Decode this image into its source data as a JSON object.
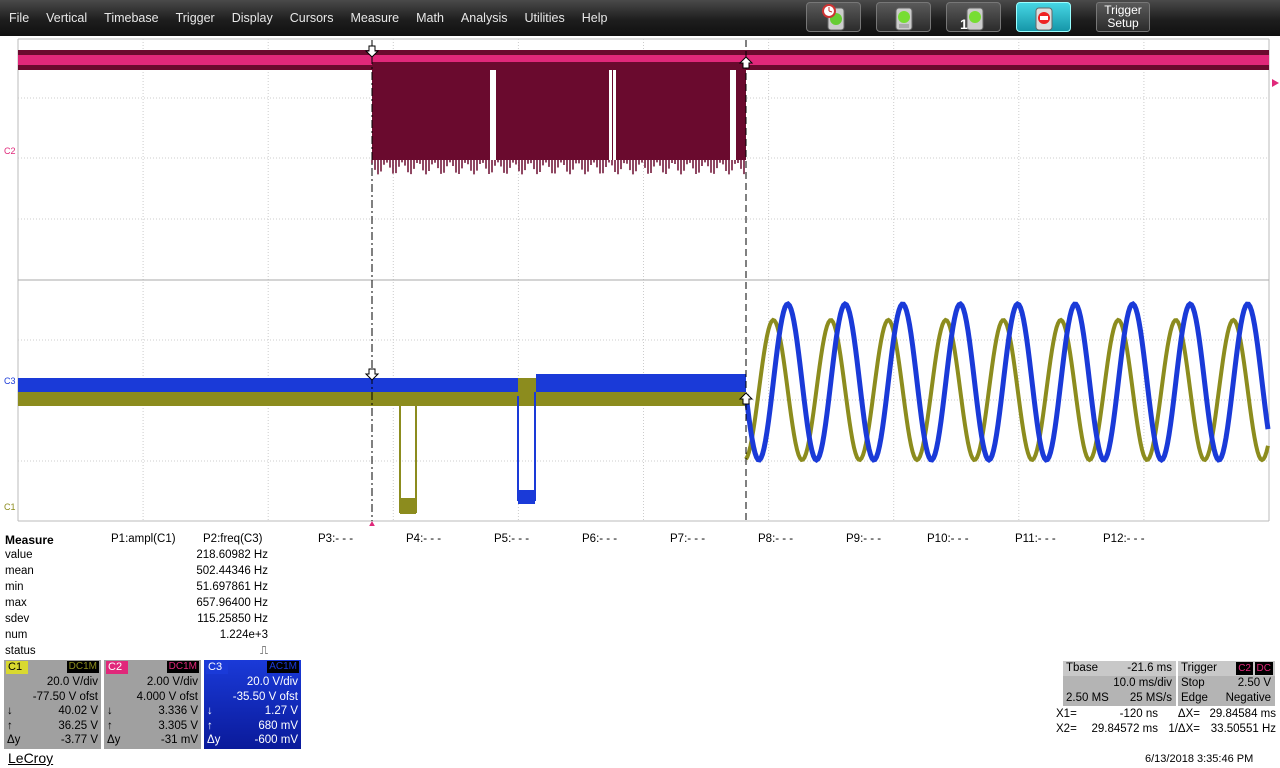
{
  "menu": [
    "File",
    "Vertical",
    "Timebase",
    "Trigger",
    "Display",
    "Cursors",
    "Measure",
    "Math",
    "Analysis",
    "Utilities",
    "Help"
  ],
  "toolbar": {
    "buttons": [
      {
        "name": "auto-setup-button",
        "icon": "alarm-traffic-light-icon"
      },
      {
        "name": "normal-trigger-button",
        "icon": "traffic-light-icon"
      },
      {
        "name": "single-trigger-button",
        "icon": "traffic-light-single-icon",
        "label": "1"
      },
      {
        "name": "stop-trigger-button",
        "icon": "traffic-light-red-icon",
        "active": true
      }
    ],
    "trigger_setup": [
      "Trigger",
      "Setup"
    ]
  },
  "markers": {
    "c2": "C2",
    "c3": "C3",
    "c1": "C1"
  },
  "measure": {
    "title": "Measure",
    "params": [
      "P1:ampl(C1)",
      "P2:freq(C3)",
      "P3:- - -",
      "P4:- - -",
      "P5:- - -",
      "P6:- - -",
      "P7:- - -",
      "P8:- - -",
      "P9:- - -",
      "P10:- - -",
      "P11:- - -",
      "P12:- - -"
    ],
    "rows": [
      {
        "label": "value",
        "p2": "218.60982 Hz"
      },
      {
        "label": "mean",
        "p2": "502.44346 Hz"
      },
      {
        "label": "min",
        "p2": "51.697861 Hz"
      },
      {
        "label": "max",
        "p2": "657.96400 Hz"
      },
      {
        "label": "sdev",
        "p2": "115.25850 Hz"
      },
      {
        "label": "num",
        "p2": "1.224e+3"
      },
      {
        "label": "status",
        "p2": "⎍"
      }
    ]
  },
  "channels": [
    {
      "id": "C1",
      "coupling": "DC1M",
      "vdiv": "20.0 V/div",
      "ofst": "-77.50 V ofst",
      "down": "40.02 V",
      "up": "36.25 V",
      "dy": "-3.77 V",
      "color": "#8c8c1e"
    },
    {
      "id": "C2",
      "coupling": "DC1M",
      "vdiv": "2.00 V/div",
      "ofst": "4.000 V ofst",
      "down": "3.336 V",
      "up": "3.305 V",
      "dy": "-31 mV",
      "color": "#e0287a"
    },
    {
      "id": "C3",
      "coupling": "AC1M",
      "vdiv": "20.0 V/div",
      "ofst": "-35.50 V ofst",
      "down": "1.27 V",
      "up": "680 mV",
      "dy": "-600 mV",
      "color": "#1a3ad8"
    }
  ],
  "cursor_symbols": {
    "down": "↓",
    "up": "↑",
    "dy": "Δy"
  },
  "timebase": {
    "label": "Tbase",
    "delay": "-21.6 ms",
    "tdiv": "10.0 ms/div",
    "samples": "2.50 MS",
    "rate": "25 MS/s"
  },
  "trigger": {
    "label": "Trigger",
    "source": "C2",
    "coupling": "DC",
    "mode": "Stop",
    "level": "2.50 V",
    "type": "Edge",
    "slope": "Negative"
  },
  "cursors": {
    "x1_label": "X1=",
    "x1": "-120 ns",
    "x2_label": "X2=",
    "x2": "29.84572 ms",
    "dx_label": "ΔX=",
    "dx": "29.84584 ms",
    "inv_label": "1/ΔX=",
    "inv": "33.50551 Hz"
  },
  "brand": "LeCroy",
  "timestamp": "6/13/2018 3:35:46 PM",
  "colors": {
    "c1": "#8c8c1e",
    "c2": "#e0287a",
    "c2_dark": "#6a0a2e",
    "c3": "#1a3ad8"
  }
}
